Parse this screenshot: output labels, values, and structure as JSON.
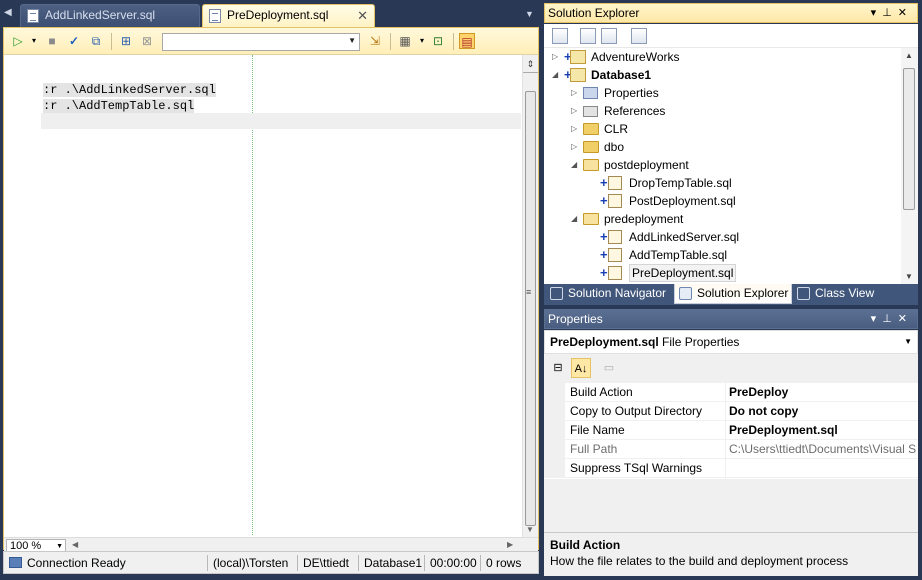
{
  "editor": {
    "tabs": [
      {
        "label": "AddLinkedServer.sql",
        "active": false
      },
      {
        "label": "PreDeployment.sql",
        "active": true
      }
    ],
    "code_lines": [
      ":r .\\AddLinkedServer.sql",
      ":r .\\AddTempTable.sql"
    ],
    "zoom": "100 %",
    "database_selector_value": ""
  },
  "status_bar": {
    "connection": "Connection Ready",
    "server": "(local)\\Torsten",
    "user": "DE\\ttiedt",
    "database": "Database1",
    "elapsed": "00:00:00",
    "rows": "0 rows"
  },
  "solution_explorer": {
    "title": "Solution Explorer",
    "tree": [
      {
        "label": "AdventureWorks",
        "kind": "project",
        "expanded": false,
        "bold": false
      },
      {
        "label": "Database1",
        "kind": "project",
        "expanded": true,
        "bold": true
      },
      {
        "label": "Properties",
        "kind": "properties"
      },
      {
        "label": "References",
        "kind": "references"
      },
      {
        "label": "CLR",
        "kind": "folder"
      },
      {
        "label": "dbo",
        "kind": "folder"
      },
      {
        "label": "postdeployment",
        "kind": "folder-open"
      },
      {
        "label": "DropTempTable.sql",
        "kind": "sql"
      },
      {
        "label": "PostDeployment.sql",
        "kind": "sql"
      },
      {
        "label": "predeployment",
        "kind": "folder-open"
      },
      {
        "label": "AddLinkedServer.sql",
        "kind": "sql"
      },
      {
        "label": "AddTempTable.sql",
        "kind": "sql"
      },
      {
        "label": "PreDeployment.sql",
        "kind": "sql",
        "selected": true
      }
    ],
    "bottom_tabs": [
      {
        "label": "Solution Navigator",
        "active": false
      },
      {
        "label": "Solution Explorer",
        "active": true
      },
      {
        "label": "Class View",
        "active": false
      }
    ]
  },
  "properties": {
    "title": "Properties",
    "object_name": "PreDeployment.sql",
    "object_type": "File Properties",
    "rows": [
      {
        "name": "Build Action",
        "value": "PreDeploy",
        "bold": true,
        "readonly": false
      },
      {
        "name": "Copy to Output Directory",
        "value": "Do not copy",
        "bold": true,
        "readonly": false
      },
      {
        "name": "File Name",
        "value": "PreDeployment.sql",
        "bold": true,
        "readonly": false
      },
      {
        "name": "Full Path",
        "value": "C:\\Users\\ttiedt\\Documents\\Visual S",
        "bold": false,
        "readonly": true
      },
      {
        "name": "Suppress TSql Warnings",
        "value": "",
        "bold": false,
        "readonly": false
      }
    ],
    "description_title": "Build Action",
    "description_text": "How the file relates to the build and deployment process"
  },
  "colors": {
    "chrome_background": "#293955",
    "active_title": "#ffe8a6",
    "active_tab": "#fff2c4"
  }
}
